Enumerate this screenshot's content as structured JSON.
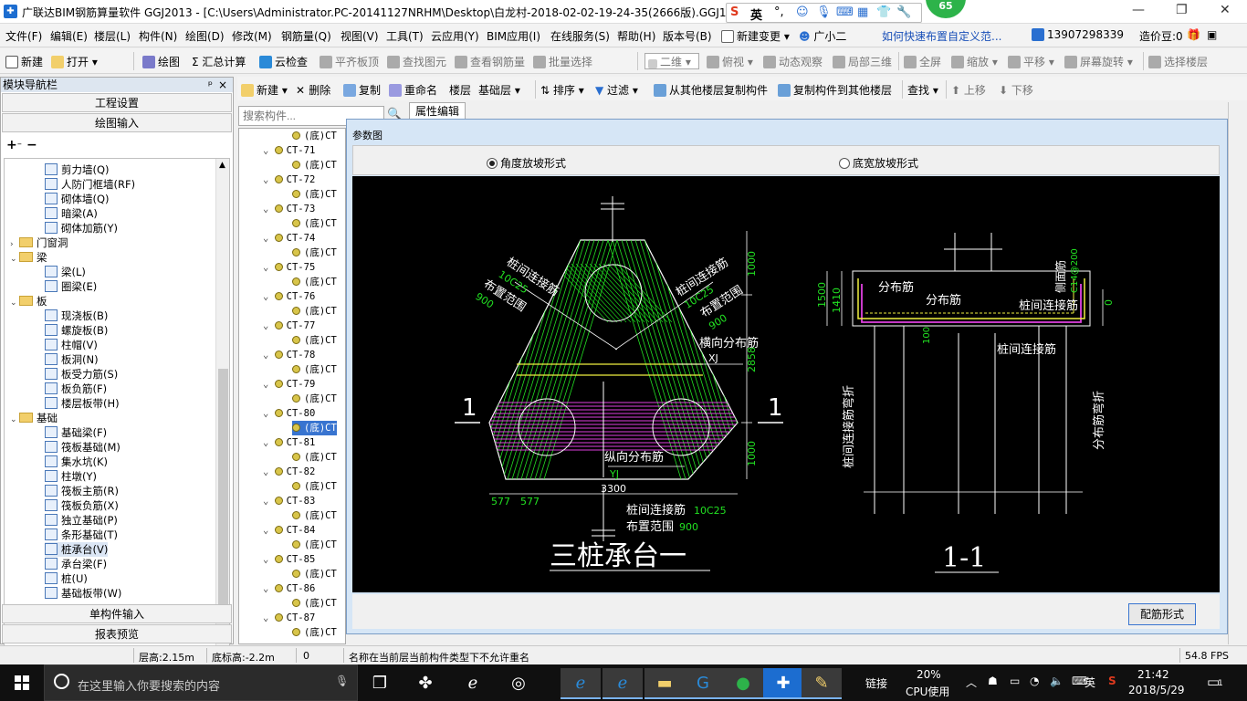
{
  "window": {
    "title": "广联达BIM钢筋算量软件 GGJ2013 - [C:\\Users\\Administrator.PC-20141127NRHM\\Desktop\\白龙村-2018-02-02-19-24-35(2666版).GGJ12]",
    "ime_label": "英",
    "badge": "65"
  },
  "menu": [
    "文件(F)",
    "编辑(E)",
    "楼层(L)",
    "构件(N)",
    "绘图(D)",
    "修改(M)",
    "钢筋量(Q)",
    "视图(V)",
    "工具(T)",
    "云应用(Y)",
    "BIM应用(I)",
    "在线服务(S)",
    "帮助(H)",
    "版本号(B)",
    "新建变更",
    "广小二",
    "如何快速布置自定义范...",
    "13907298339",
    "造价豆:0"
  ],
  "toolbar1": [
    "新建",
    "打开",
    "绘图",
    "Σ 汇总计算",
    "云检查",
    "平齐板顶",
    "查找图元",
    "查看钢筋量",
    "批量选择",
    "二维",
    "俯视",
    "动态观察",
    "局部三维",
    "全屏",
    "缩放",
    "平移",
    "屏幕旋转",
    "选择楼层"
  ],
  "toolbar2": [
    "新建",
    "删除",
    "复制",
    "重命名",
    "楼层",
    "基础层",
    "排序",
    "过滤",
    "从其他楼层复制构件",
    "复制构件到其他楼层",
    "查找",
    "上移",
    "下移"
  ],
  "nav": {
    "header": "模块导航栏",
    "pin": "ᵖ",
    "close": "×",
    "project_settings": "工程设置",
    "drawing_input": "绘图输入",
    "single_input": "单构件输入",
    "report_preview": "报表预览",
    "tree": [
      {
        "label": "剪力墙(Q)",
        "level": 2
      },
      {
        "label": "人防门框墙(RF)",
        "level": 2
      },
      {
        "label": "砌体墙(Q)",
        "level": 2
      },
      {
        "label": "暗梁(A)",
        "level": 2
      },
      {
        "label": "砌体加筋(Y)",
        "level": 2
      },
      {
        "label": "门窗洞",
        "level": 1,
        "folder": true,
        "expanded": false
      },
      {
        "label": "梁",
        "level": 1,
        "folder": true,
        "expanded": true
      },
      {
        "label": "梁(L)",
        "level": 2
      },
      {
        "label": "圈梁(E)",
        "level": 2
      },
      {
        "label": "板",
        "level": 1,
        "folder": true,
        "expanded": true
      },
      {
        "label": "现浇板(B)",
        "level": 2
      },
      {
        "label": "螺旋板(B)",
        "level": 2
      },
      {
        "label": "柱帽(V)",
        "level": 2
      },
      {
        "label": "板洞(N)",
        "level": 2
      },
      {
        "label": "板受力筋(S)",
        "level": 2
      },
      {
        "label": "板负筋(F)",
        "level": 2
      },
      {
        "label": "楼层板带(H)",
        "level": 2
      },
      {
        "label": "基础",
        "level": 1,
        "folder": true,
        "expanded": true
      },
      {
        "label": "基础梁(F)",
        "level": 2
      },
      {
        "label": "筏板基础(M)",
        "level": 2
      },
      {
        "label": "集水坑(K)",
        "level": 2
      },
      {
        "label": "柱墩(Y)",
        "level": 2
      },
      {
        "label": "筏板主筋(R)",
        "level": 2
      },
      {
        "label": "筏板负筋(X)",
        "level": 2
      },
      {
        "label": "独立基础(P)",
        "level": 2
      },
      {
        "label": "条形基础(T)",
        "level": 2
      },
      {
        "label": "桩承台(V)",
        "level": 2,
        "selected": true
      },
      {
        "label": "承台梁(F)",
        "level": 2
      },
      {
        "label": "桩(U)",
        "level": 2
      },
      {
        "label": "基础板带(W)",
        "level": 2
      }
    ]
  },
  "search": {
    "placeholder": "搜索构件..."
  },
  "component_list": [
    {
      "label": "(底)CT",
      "child": true
    },
    {
      "label": "CT-71",
      "child": false
    },
    {
      "label": "(底)CT",
      "child": true
    },
    {
      "label": "CT-72",
      "child": false
    },
    {
      "label": "(底)CT",
      "child": true
    },
    {
      "label": "CT-73",
      "child": false
    },
    {
      "label": "(底)CT",
      "child": true
    },
    {
      "label": "CT-74",
      "child": false
    },
    {
      "label": "(底)CT",
      "child": true
    },
    {
      "label": "CT-75",
      "child": false
    },
    {
      "label": "(底)CT",
      "child": true
    },
    {
      "label": "CT-76",
      "child": false
    },
    {
      "label": "(底)CT",
      "child": true
    },
    {
      "label": "CT-77",
      "child": false
    },
    {
      "label": "(底)CT",
      "child": true
    },
    {
      "label": "CT-78",
      "child": false
    },
    {
      "label": "(底)CT",
      "child": true
    },
    {
      "label": "CT-79",
      "child": false
    },
    {
      "label": "(底)CT",
      "child": true
    },
    {
      "label": "CT-80",
      "child": false
    },
    {
      "label": "(底)CT",
      "child": true,
      "selected": true
    },
    {
      "label": "CT-81",
      "child": false
    },
    {
      "label": "(底)CT",
      "child": true
    },
    {
      "label": "CT-82",
      "child": false
    },
    {
      "label": "(底)CT",
      "child": true
    },
    {
      "label": "CT-83",
      "child": false
    },
    {
      "label": "(底)CT",
      "child": true
    },
    {
      "label": "CT-84",
      "child": false
    },
    {
      "label": "(底)CT",
      "child": true
    },
    {
      "label": "CT-85",
      "child": false
    },
    {
      "label": "(底)CT",
      "child": true
    },
    {
      "label": "CT-86",
      "child": false
    },
    {
      "label": "(底)CT",
      "child": true
    },
    {
      "label": "CT-87",
      "child": false
    },
    {
      "label": "(底)CT",
      "child": true
    }
  ],
  "property_tab": "属性编辑",
  "dialog": {
    "title": "参数图",
    "radio_angle": "角度放坡形式",
    "radio_width": "底宽放坡形式",
    "rebar_button": "配筋形式",
    "drawing": {
      "title_main": "三桩承台一",
      "title_section": "1-1",
      "section_mark": "1",
      "pile_rebar_1": "桩间连接筋",
      "pile_rebar_1_spec": "10C25",
      "pile_range_1": "布置范围",
      "pile_range_1_value": "900",
      "pile_rebar_2": "桩间连接筋",
      "pile_rebar_2_spec": "10C25",
      "pile_range_2": "布置范围",
      "pile_range_2_value": "900",
      "transverse_rebar": "横向分布筋",
      "transverse_code": "XJ",
      "longitudinal_rebar": "纵向分布筋",
      "longitudinal_code": "YJ",
      "bottom_rebar": "桩间连接筋",
      "bottom_rebar_spec": "10C25",
      "bottom_range": "布置范围",
      "bottom_range_value": "900",
      "dim_1000_top": "1000",
      "dim_2858": "2858",
      "dim_1000_bottom": "1000",
      "dim_577_a": "577",
      "dim_577_b": "577",
      "dim_3300": "3300",
      "sec_distribution_1": "分布筋",
      "sec_distribution_2": "分布筋",
      "sec_side_rebar": "侧面筋",
      "sec_side_spec": "C14@200",
      "sec_pile_link": "桩间连接筋",
      "sec_pile_link_bottom": "桩间连接筋",
      "sec_pile_bend": "桩间连接筋弯折",
      "sec_dist_bend": "分布筋弯折",
      "sec_dim_1500": "1500",
      "sec_dim_1410": "1410",
      "sec_dim_100": "100",
      "sec_dim_0": "0"
    }
  },
  "status": {
    "floor_height": "层高:2.15m",
    "base_height": "底标高:-2.2m",
    "zero": "0",
    "message": "名称在当前层当前构件类型下不允许重名",
    "fps": "54.8 FPS"
  },
  "taskbar": {
    "search_placeholder": "在这里输入你要搜索的内容",
    "link": "链接",
    "cpu_percent": "20%",
    "cpu_label": "CPU使用",
    "ime": "英",
    "time": "21:42",
    "date": "2018/5/29",
    "notification_count": "1"
  },
  "colors": {
    "drawing_bg": "#000000",
    "rebar_green": "#22e022",
    "rebar_magenta": "#e040e0",
    "rebar_yellow": "#f0f040",
    "dimension_green": "#22e022",
    "selection_blue": "#3874d0"
  }
}
